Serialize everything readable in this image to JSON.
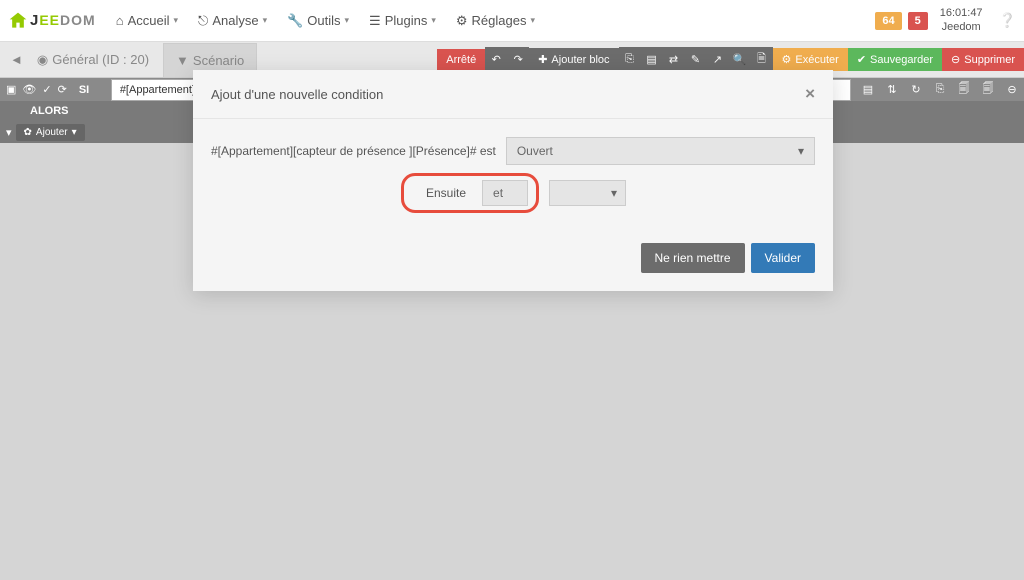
{
  "brand": {
    "name": "JEEDOM"
  },
  "nav": {
    "accueil": "Accueil",
    "analyse": "Analyse",
    "outils": "Outils",
    "plugins": "Plugins",
    "reglages": "Réglages"
  },
  "topStatus": {
    "badge1": "64",
    "badge2": "5",
    "time": "16:01:47",
    "system": "Jeedom"
  },
  "toolbar": {
    "general": "Général (ID : 20)",
    "scenario_tab": "Scénario",
    "state": "Arrêté",
    "add_block": "Ajouter bloc",
    "execute": "Exécuter",
    "save": "Sauvegarder",
    "delete": "Supprimer"
  },
  "scenario": {
    "si": "SI",
    "condition_input": "#[Appartement][capteur",
    "alors": "ALORS",
    "ajouter": "Ajouter"
  },
  "modal": {
    "title": "Ajout d'une nouvelle condition",
    "condition_text": "#[Appartement][capteur de présence ][Présence]# est",
    "value_select": "Ouvert",
    "ensuite": "Ensuite",
    "operator": "et",
    "cancel": "Ne rien mettre",
    "confirm": "Valider"
  }
}
